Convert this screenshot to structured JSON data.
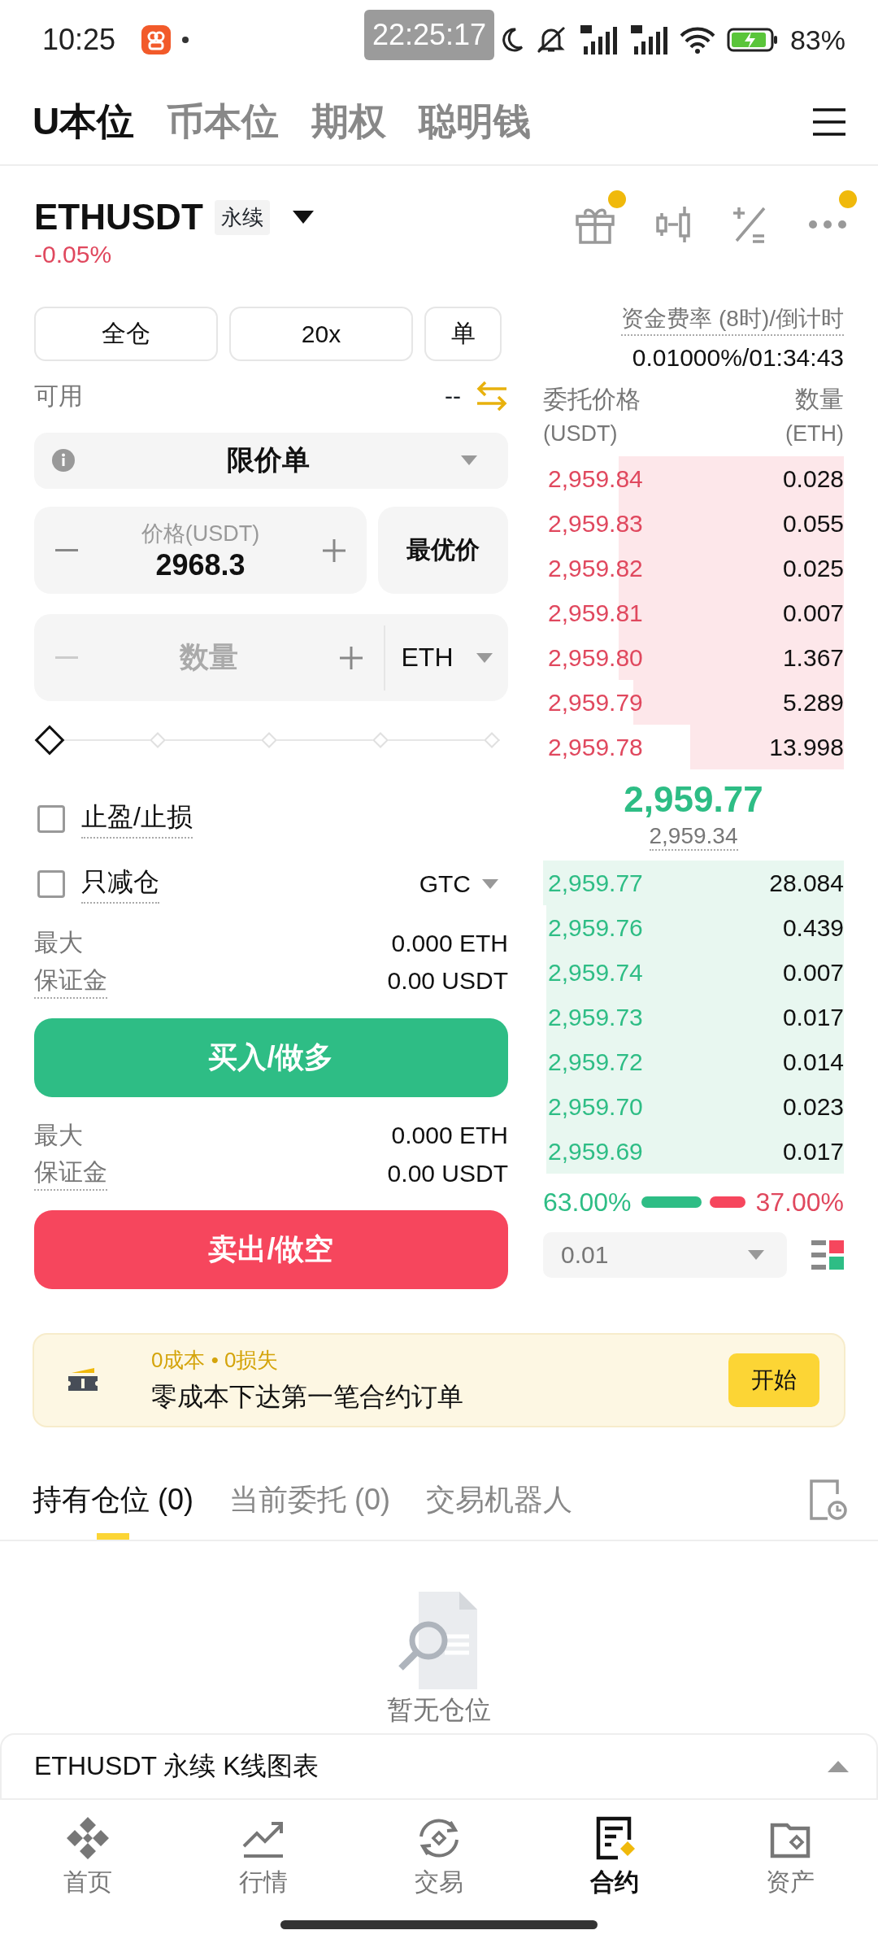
{
  "status_bar": {
    "time": "10:25",
    "recorder_time": "22:25:17",
    "battery": "83%"
  },
  "market_tabs": [
    {
      "label": "U本位",
      "selected": true
    },
    {
      "label": "币本位",
      "selected": false
    },
    {
      "label": "期权",
      "selected": false
    },
    {
      "label": "聪明钱",
      "selected": false
    }
  ],
  "header": {
    "symbol": "ETHUSDT",
    "tag": "永续",
    "change": "-0.05%"
  },
  "toolbar": [
    {
      "kind": "gift",
      "dot": true
    },
    {
      "kind": "candles",
      "dot": false
    },
    {
      "kind": "calculator",
      "dot": false
    },
    {
      "kind": "more",
      "dot": true
    }
  ],
  "order_form": {
    "margin_mode": "全仓",
    "leverage": "20x",
    "position_mode": "单",
    "available_label": "可用",
    "available_value": "--",
    "order_type": "限价单",
    "price": {
      "label": "价格(USDT)",
      "value": "2968.3"
    },
    "best_price": "最优价",
    "quantity": {
      "placeholder": "数量",
      "unit": "ETH"
    },
    "slider": {
      "level": 0
    },
    "options": [
      {
        "label": "止盈/止损",
        "checked": false
      },
      {
        "label": "只减仓",
        "checked": false
      }
    ],
    "time_in_force": "GTC",
    "sides": [
      {
        "kind": "buy",
        "max_label": "最大",
        "max_value": "0.000 ETH",
        "margin_label": "保证金",
        "margin_value": "0.00 USDT",
        "button": "买入/做多"
      },
      {
        "kind": "sell",
        "max_label": "最大",
        "max_value": "0.000 ETH",
        "margin_label": "保证金",
        "margin_value": "0.00 USDT",
        "button": "卖出/做空"
      }
    ]
  },
  "order_book": {
    "funding_label": "资金费率 (8时)/倒计时",
    "funding_value": "0.01000%/01:34:43",
    "price_header": "委托价格",
    "price_unit": "(USDT)",
    "qty_header": "数量",
    "qty_unit": "(ETH)",
    "asks": [
      {
        "price": "2,959.84",
        "qty": "0.028"
      },
      {
        "price": "2,959.83",
        "qty": "0.055"
      },
      {
        "price": "2,959.82",
        "qty": "0.025"
      },
      {
        "price": "2,959.81",
        "qty": "0.007"
      },
      {
        "price": "2,959.80",
        "qty": "1.367"
      },
      {
        "price": "2,959.79",
        "qty": "5.289"
      },
      {
        "price": "2,959.78",
        "qty": "13.998"
      }
    ],
    "last_price": "2,959.77",
    "mark_price": "2,959.34",
    "bids": [
      {
        "price": "2,959.77",
        "qty": "28.084"
      },
      {
        "price": "2,959.76",
        "qty": "0.439"
      },
      {
        "price": "2,959.74",
        "qty": "0.007"
      },
      {
        "price": "2,959.73",
        "qty": "0.017"
      },
      {
        "price": "2,959.72",
        "qty": "0.014"
      },
      {
        "price": "2,959.70",
        "qty": "0.023"
      },
      {
        "price": "2,959.69",
        "qty": "0.017"
      }
    ],
    "buy_ratio": "63.00%",
    "sell_ratio": "37.00%",
    "precision": "0.01"
  },
  "promo": {
    "subtitle": "0成本 • 0损失",
    "text": "零成本下达第一笔合约订单",
    "button": "开始"
  },
  "position_tabs": [
    {
      "label": "持有仓位 (0)",
      "selected": true
    },
    {
      "label": "当前委托 (0)",
      "selected": false
    },
    {
      "label": "交易机器人",
      "selected": false
    }
  ],
  "empty_text": "暂无仓位",
  "chart_bar": "ETHUSDT 永续 K线图表",
  "nav": [
    {
      "kind": "home",
      "label": "首页",
      "selected": false
    },
    {
      "kind": "markets",
      "label": "行情",
      "selected": false
    },
    {
      "kind": "trade",
      "label": "交易",
      "selected": false
    },
    {
      "kind": "futures",
      "label": "合约",
      "selected": true
    },
    {
      "kind": "assets",
      "label": "资产",
      "selected": false
    }
  ]
}
